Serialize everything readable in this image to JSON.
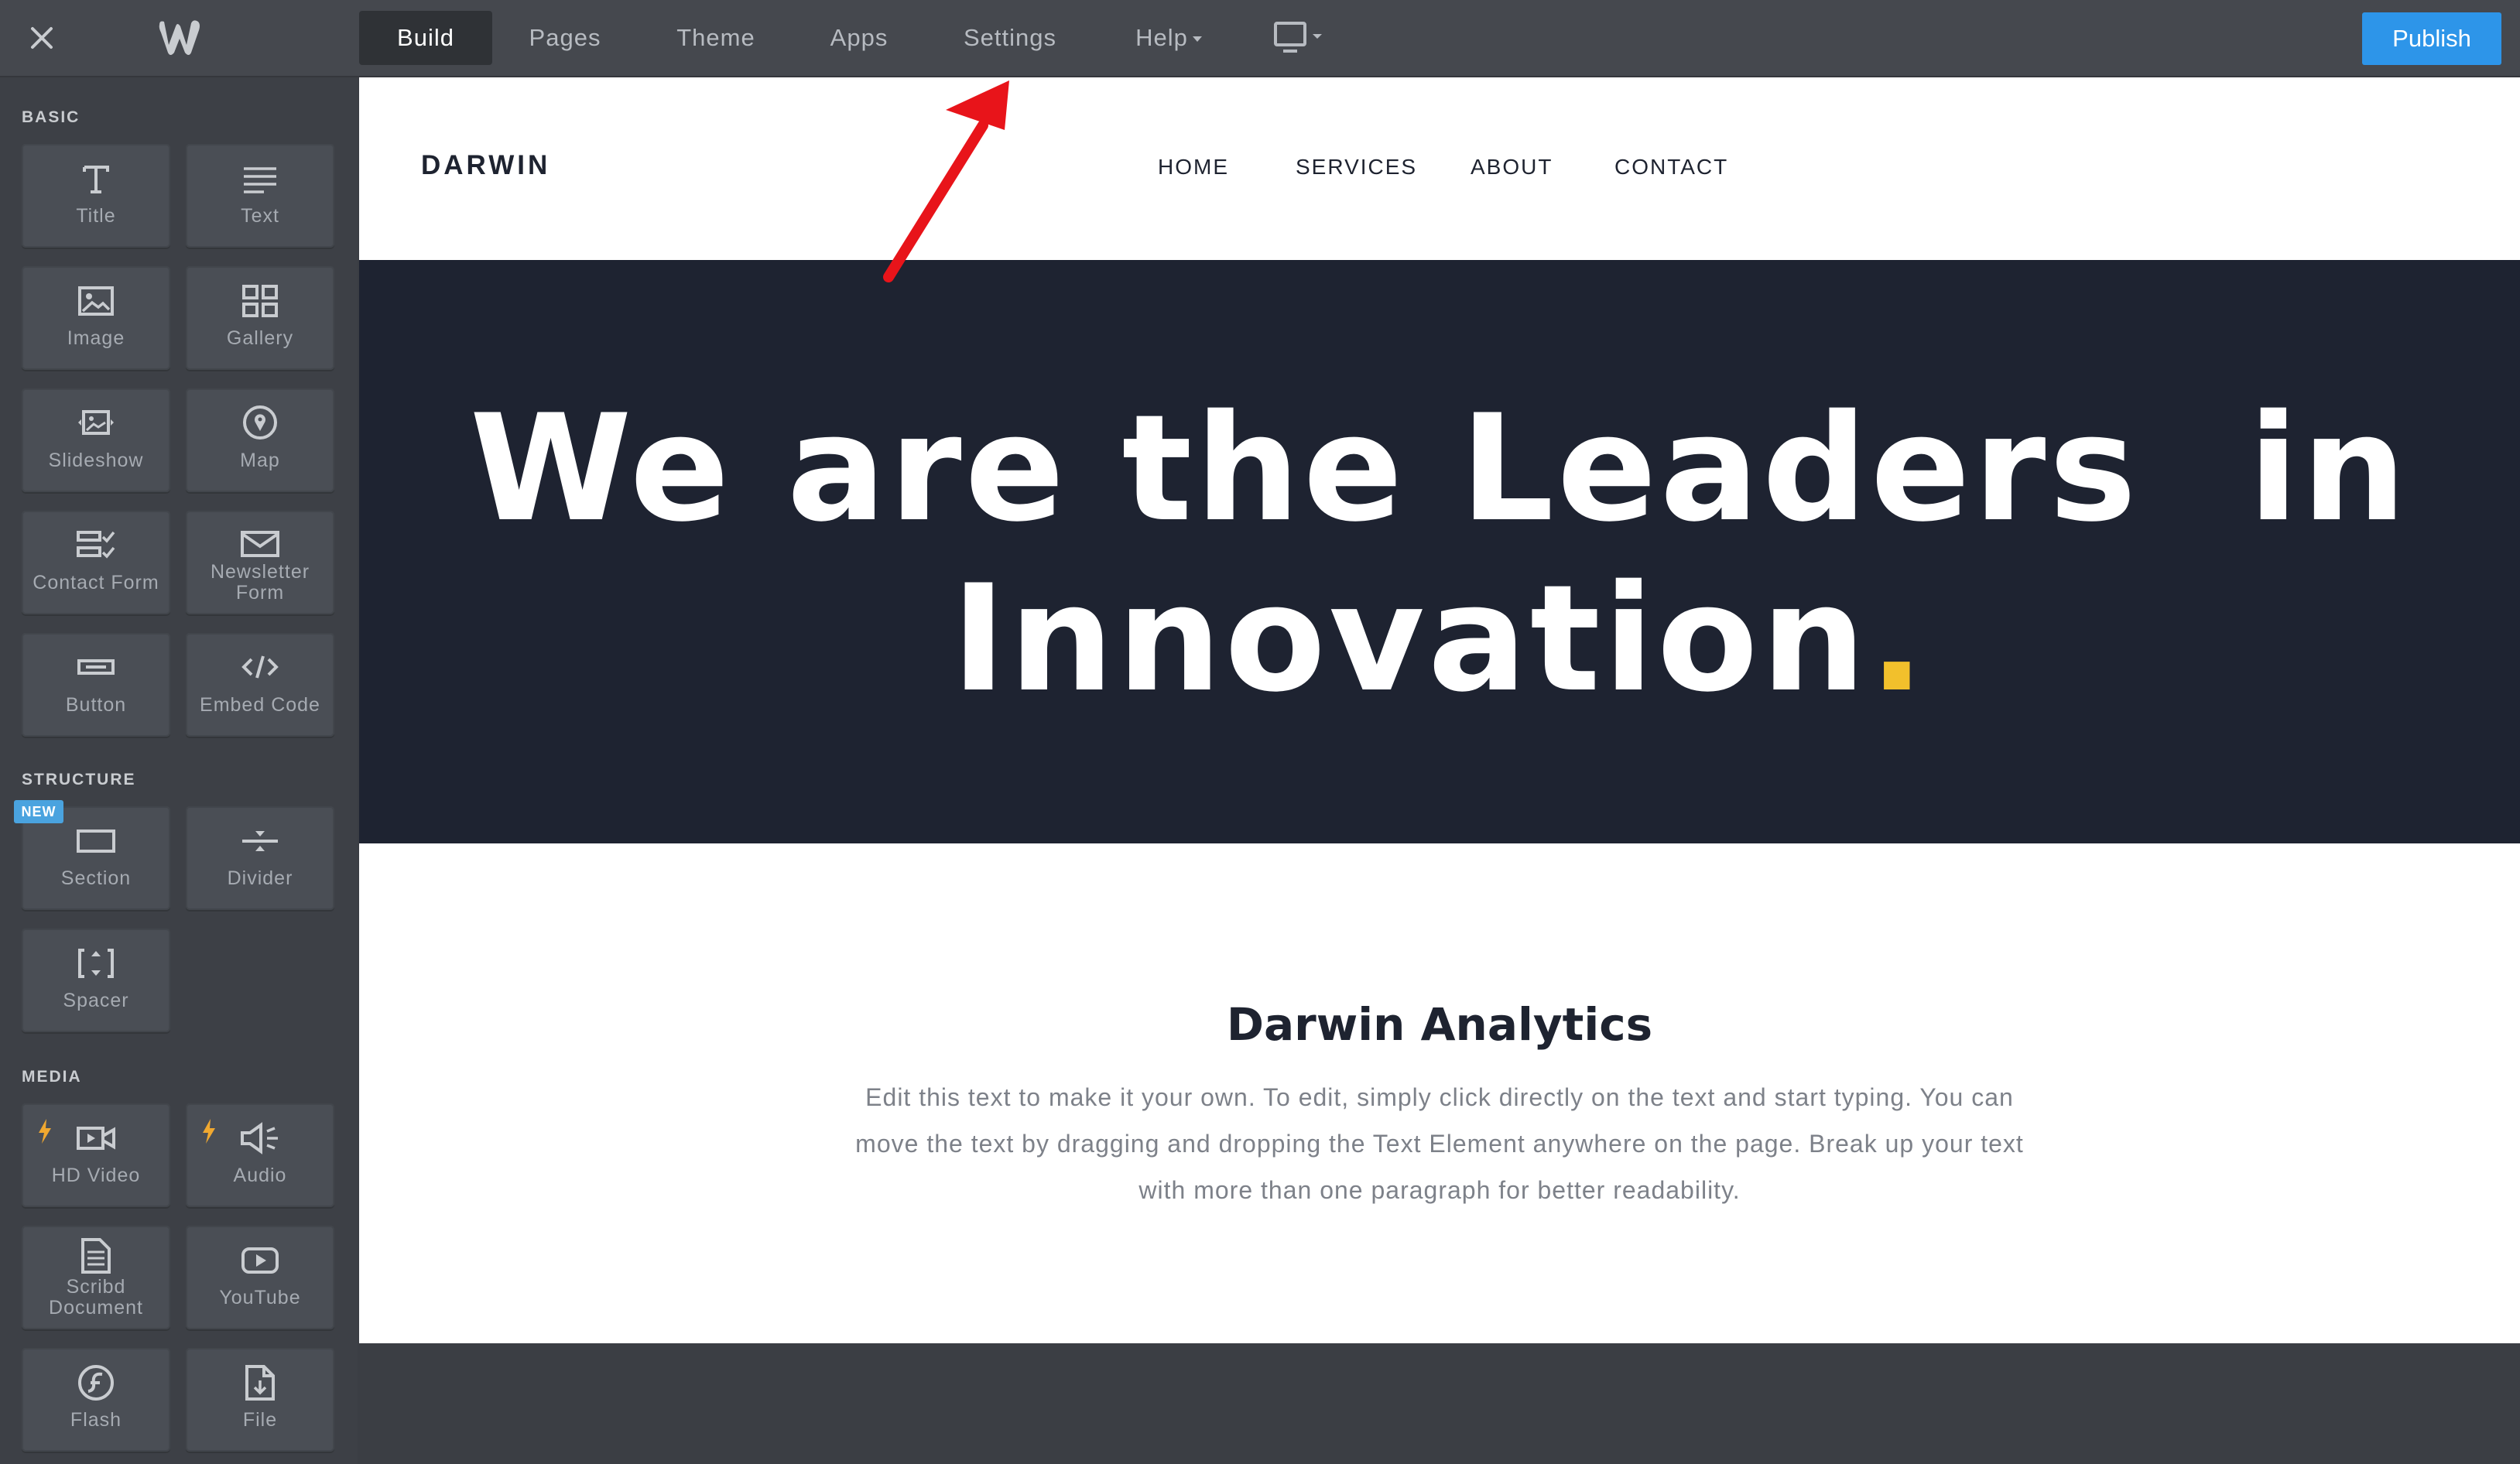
{
  "toolbar": {
    "tabs": [
      {
        "label": "Build",
        "active": true
      },
      {
        "label": "Pages"
      },
      {
        "label": "Theme"
      },
      {
        "label": "Apps"
      },
      {
        "label": "Settings"
      },
      {
        "label": "Help"
      }
    ],
    "publish_label": "Publish",
    "device_icon": "desktop-icon",
    "close_icon": "close-icon",
    "logo_icon": "weebly-logo-icon"
  },
  "sidebar": {
    "sections": [
      {
        "label": "BASIC",
        "items": [
          {
            "label": "Title",
            "icon": "title-icon"
          },
          {
            "label": "Text",
            "icon": "text-icon"
          },
          {
            "label": "Image",
            "icon": "image-icon"
          },
          {
            "label": "Gallery",
            "icon": "gallery-icon"
          },
          {
            "label": "Slideshow",
            "icon": "slideshow-icon"
          },
          {
            "label": "Map",
            "icon": "map-pin-icon"
          },
          {
            "label": "Contact Form",
            "icon": "contact-form-icon"
          },
          {
            "label": "Newsletter Form",
            "icon": "envelope-icon"
          },
          {
            "label": "Button",
            "icon": "button-icon"
          },
          {
            "label": "Embed Code",
            "icon": "code-icon"
          }
        ]
      },
      {
        "label": "STRUCTURE",
        "badge": "NEW",
        "items": [
          {
            "label": "Section",
            "icon": "section-icon"
          },
          {
            "label": "Divider",
            "icon": "divider-icon"
          },
          {
            "label": "Spacer",
            "icon": "spacer-icon"
          }
        ]
      },
      {
        "label": "MEDIA",
        "items": [
          {
            "label": "HD Video",
            "icon": "video-icon"
          },
          {
            "label": "Audio",
            "icon": "audio-icon"
          },
          {
            "label": "Scribd Document",
            "icon": "document-icon"
          },
          {
            "label": "YouTube",
            "icon": "youtube-icon"
          },
          {
            "label": "Flash",
            "icon": "flash-icon"
          },
          {
            "label": "File",
            "icon": "file-icon"
          }
        ]
      }
    ]
  },
  "site": {
    "brand": "DARWIN",
    "nav": [
      "HOME",
      "SERVICES",
      "ABOUT",
      "CONTACT"
    ],
    "hero_line1": "We are the Leaders  in",
    "hero_line2": "Innovation",
    "hero_dot": ".",
    "section_title": "Darwin Analytics",
    "section_body": "Edit this text to make it your own. To edit, simply click directly on the text and start typing. You can move the text by dragging and dropping the Text Element anywhere on the page. Break up your text with more than one paragraph for better readability."
  },
  "colors": {
    "topbar": "#45484e",
    "sidebar": "#3d4046",
    "hero_bg": "#1e2331",
    "accent_dot": "#f2c02c",
    "publish": "#2d95e9",
    "annotation_arrow": "#e8141a"
  },
  "annotation": {
    "type": "arrow",
    "target": "Settings"
  }
}
